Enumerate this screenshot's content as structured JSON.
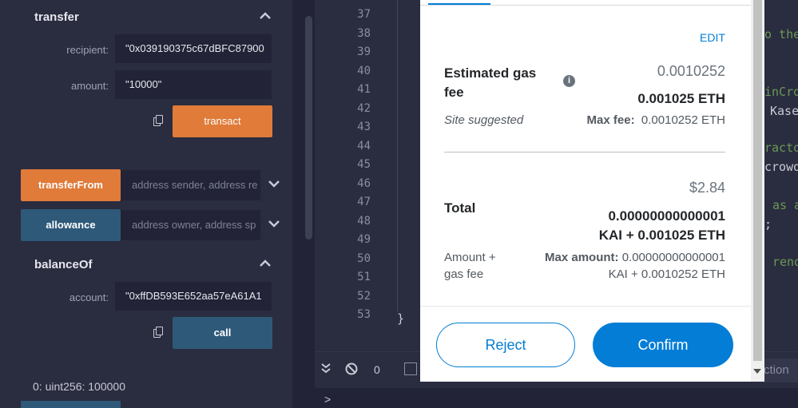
{
  "transfer": {
    "title": "transfer",
    "recipient_label": "recipient:",
    "recipient_value": "\"0x039190375c67dBFC87900",
    "amount_label": "amount:",
    "amount_value": "\"10000\"",
    "transact_label": "transact"
  },
  "transferFrom": {
    "label": "transferFrom",
    "placeholder": "address sender, address re"
  },
  "allowance": {
    "label": "allowance",
    "placeholder": "address owner, address sp"
  },
  "balanceOf": {
    "title": "balanceOf",
    "account_label": "account:",
    "account_value": "\"0xffDB593E652aa57eA61A1",
    "call_label": "call",
    "result": "0: uint256: 100000"
  },
  "editor": {
    "line_numbers": [
      "37",
      "38",
      "39",
      "40",
      "41",
      "42",
      "43",
      "44",
      "45",
      "46",
      "47",
      "48",
      "49",
      "50",
      "51",
      "52",
      "53"
    ],
    "closing_brace": "}",
    "right_fragments": [
      "o the",
      "inCro",
      "Kase",
      "racto",
      "crowd",
      "as a",
      ";",
      "rend"
    ]
  },
  "bottombar": {
    "count": "0",
    "right_text": "ction"
  },
  "terminal": {
    "prompt": ">"
  },
  "metamask": {
    "edit_label": "EDIT",
    "gas_title": "Estimated gas fee",
    "gas_value_top": "0.0010252",
    "gas_value_eth": "0.001025 ETH",
    "site_suggested": "Site suggested",
    "max_fee_label": "Max fee:",
    "max_fee_value": "0.0010252 ETH",
    "total_usd": "$2.84",
    "total_label": "Total",
    "total_line1": "0.00000000000001",
    "total_line2": "KAI + 0.001025 ETH",
    "amount_gas_label1": "Amount +",
    "amount_gas_label2": "gas fee",
    "max_amount_label": "Max amount:",
    "max_amount_value1": "0.00000000000001",
    "max_amount_value2": "KAI + 0.0010252 ETH",
    "reject_label": "Reject",
    "confirm_label": "Confirm"
  },
  "colors": {
    "orange": "#e07b39",
    "blue": "#2e5979",
    "metamask_blue": "#037dd6"
  }
}
